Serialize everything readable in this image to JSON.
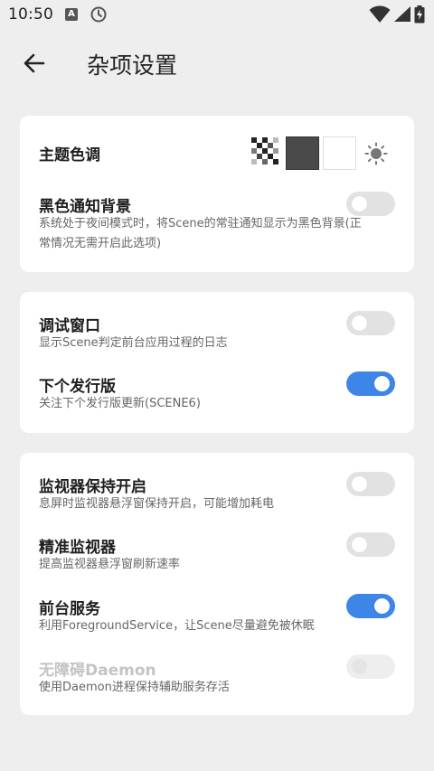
{
  "status_bar": {
    "time": "10:50",
    "notification_icons": [
      "a-icon",
      "clock-icon"
    ],
    "a_label": "A",
    "right_icons": [
      "wifi-icon",
      "signal-icon",
      "battery-charging-icon"
    ]
  },
  "app_bar": {
    "back_icon": "arrow-back-icon",
    "title": "杂项设置"
  },
  "colors": {
    "background": "#EEEEEE",
    "card": "#FFFFFF",
    "accent": "#3D86E8",
    "toggle_off": "#E2E2E2"
  },
  "card1": {
    "theme_label": "主题色调",
    "theme_options": [
      "checker-icon",
      "dark-swatch",
      "light-swatch",
      "sun-icon"
    ],
    "black_notif_title": "黑色通知背景",
    "black_notif_desc": "系统处于夜间模式时，将Scene的常驻通知显示为黑色背景(正常情况无需开启此选项)",
    "black_notif_on": false
  },
  "card2": {
    "debug_title": "调试窗口",
    "debug_desc": "显示Scene判定前台应用过程的日志",
    "debug_on": false,
    "next_title": "下个发行版",
    "next_desc": "关注下个发行版更新(SCENE6)",
    "next_on": true
  },
  "card3": {
    "monitor_keep_title": "监视器保持开启",
    "monitor_keep_desc": "息屏时监视器悬浮窗保持开启，可能增加耗电",
    "monitor_keep_on": false,
    "precise_title": "精准监视器",
    "precise_desc": "提高监视器悬浮窗刷新速率",
    "precise_on": false,
    "foreground_title": "前台服务",
    "foreground_desc": "利用ForegroundService，让Scene尽量避免被休眠",
    "foreground_on": true,
    "daemon_title": "无障碍Daemon",
    "daemon_desc": "使用Daemon进程保持辅助服务存活",
    "daemon_on": false,
    "daemon_enabled": false
  }
}
